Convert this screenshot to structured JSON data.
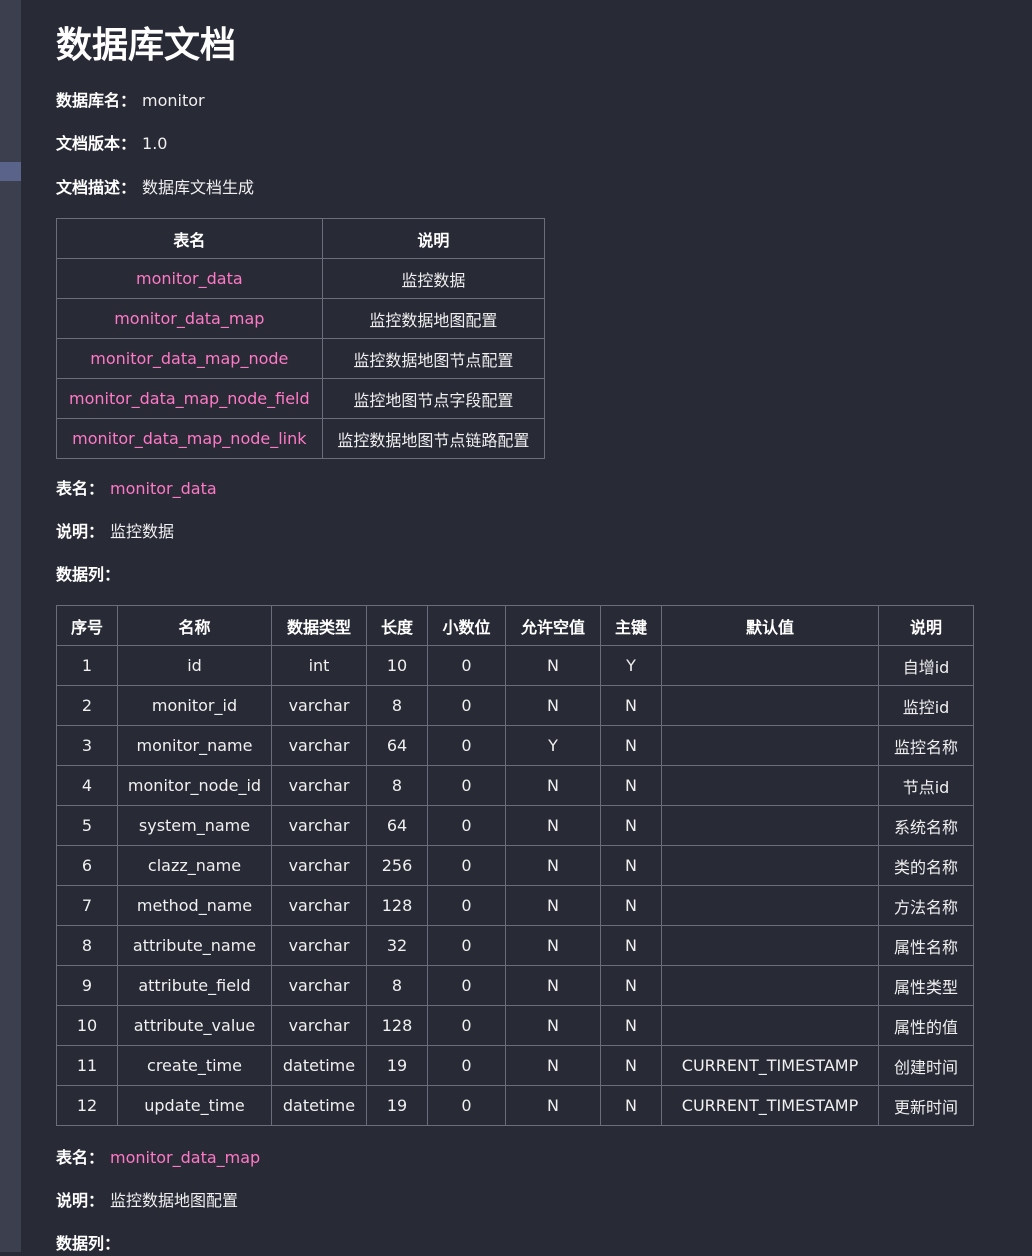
{
  "title": "数据库文档",
  "meta": {
    "db_name_label": "数据库名：",
    "db_name": "monitor",
    "version_label": "文档版本：",
    "version": "1.0",
    "desc_label": "文档描述：",
    "desc": "数据库文档生成"
  },
  "index_table": {
    "headers": [
      "表名",
      "说明"
    ],
    "rows": [
      [
        "monitor_data",
        "监控数据"
      ],
      [
        "monitor_data_map",
        "监控数据地图配置"
      ],
      [
        "monitor_data_map_node",
        "监控数据地图节点配置"
      ],
      [
        "monitor_data_map_node_field",
        "监控地图节点字段配置"
      ],
      [
        "monitor_data_map_node_link",
        "监控数据地图节点链路配置"
      ]
    ]
  },
  "section1": {
    "table_label": "表名：",
    "table_name": "monitor_data",
    "desc_label": "说明：",
    "desc": "监控数据",
    "cols_label": "数据列："
  },
  "columns_table": {
    "headers": [
      "序号",
      "名称",
      "数据类型",
      "长度",
      "小数位",
      "允许空值",
      "主键",
      "默认值",
      "说明"
    ],
    "rows": [
      [
        "1",
        "id",
        "int",
        "10",
        "0",
        "N",
        "Y",
        "",
        "自增id"
      ],
      [
        "2",
        "monitor_id",
        "varchar",
        "8",
        "0",
        "N",
        "N",
        "",
        "监控id"
      ],
      [
        "3",
        "monitor_name",
        "varchar",
        "64",
        "0",
        "Y",
        "N",
        "",
        "监控名称"
      ],
      [
        "4",
        "monitor_node_id",
        "varchar",
        "8",
        "0",
        "N",
        "N",
        "",
        "节点id"
      ],
      [
        "5",
        "system_name",
        "varchar",
        "64",
        "0",
        "N",
        "N",
        "",
        "系统名称"
      ],
      [
        "6",
        "clazz_name",
        "varchar",
        "256",
        "0",
        "N",
        "N",
        "",
        "类的名称"
      ],
      [
        "7",
        "method_name",
        "varchar",
        "128",
        "0",
        "N",
        "N",
        "",
        "方法名称"
      ],
      [
        "8",
        "attribute_name",
        "varchar",
        "32",
        "0",
        "N",
        "N",
        "",
        "属性名称"
      ],
      [
        "9",
        "attribute_field",
        "varchar",
        "8",
        "0",
        "N",
        "N",
        "",
        "属性类型"
      ],
      [
        "10",
        "attribute_value",
        "varchar",
        "128",
        "0",
        "N",
        "N",
        "",
        "属性的值"
      ],
      [
        "11",
        "create_time",
        "datetime",
        "19",
        "0",
        "N",
        "N",
        "CURRENT_TIMESTAMP",
        "创建时间"
      ],
      [
        "12",
        "update_time",
        "datetime",
        "19",
        "0",
        "N",
        "N",
        "CURRENT_TIMESTAMP",
        "更新时间"
      ]
    ]
  },
  "section2": {
    "table_label": "表名：",
    "table_name": "monitor_data_map",
    "desc_label": "说明：",
    "desc": "监控数据地图配置",
    "cols_label": "数据列："
  }
}
